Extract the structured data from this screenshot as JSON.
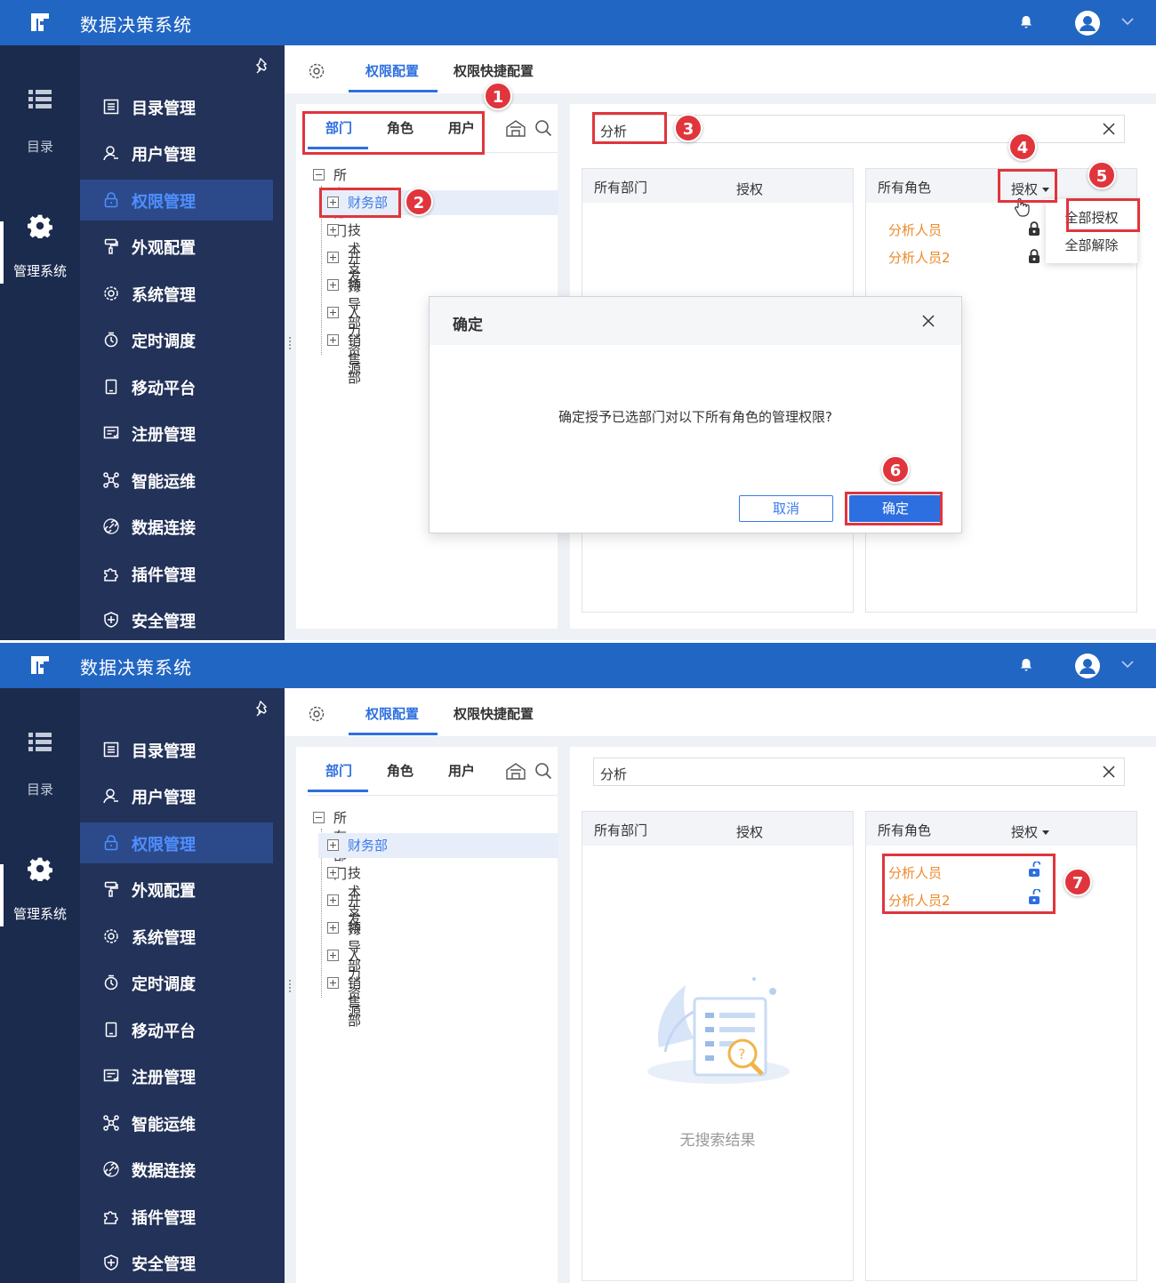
{
  "app": {
    "title": "数据决策系统"
  },
  "rail": {
    "catalog_label": "目录",
    "manage_label": "管理系统"
  },
  "menu": {
    "items": [
      {
        "label": "目录管理"
      },
      {
        "label": "用户管理"
      },
      {
        "label": "权限管理"
      },
      {
        "label": "外观配置"
      },
      {
        "label": "系统管理"
      },
      {
        "label": "定时调度"
      },
      {
        "label": "移动平台"
      },
      {
        "label": "注册管理"
      },
      {
        "label": "智能运维"
      },
      {
        "label": "数据连接"
      },
      {
        "label": "插件管理"
      },
      {
        "label": "安全管理"
      }
    ]
  },
  "tabs": {
    "permission_config": "权限配置",
    "quick_config": "权限快捷配置"
  },
  "subtabs": {
    "dept": "部门",
    "role": "角色",
    "user": "用户"
  },
  "tree": {
    "root": "所有部门",
    "children": [
      "财务部",
      "技术支持",
      "开发",
      "领导部",
      "人力资源",
      "销售部"
    ]
  },
  "search": {
    "value": "分析"
  },
  "dept_box": {
    "col1": "所有部门",
    "col2": "授权",
    "empty_text": "无搜索结果"
  },
  "role_box": {
    "col1": "所有角色",
    "col2": "授权",
    "roles": [
      "分析人员",
      "分析人员2"
    ]
  },
  "dropdown": {
    "grant_all": "全部授权",
    "revoke_all": "全部解除"
  },
  "dialog": {
    "title": "确定",
    "message": "确定授予已选部门对以下所有角色的管理权限?",
    "cancel": "取消",
    "confirm": "确定"
  },
  "badges": [
    "1",
    "2",
    "3",
    "4",
    "5",
    "6",
    "7"
  ],
  "colors": {
    "topbar": "#2266c4",
    "sidebar": "#233259",
    "accent": "#2d6fe0",
    "role_text": "#ee8a2a",
    "annotation": "#e0353c"
  }
}
